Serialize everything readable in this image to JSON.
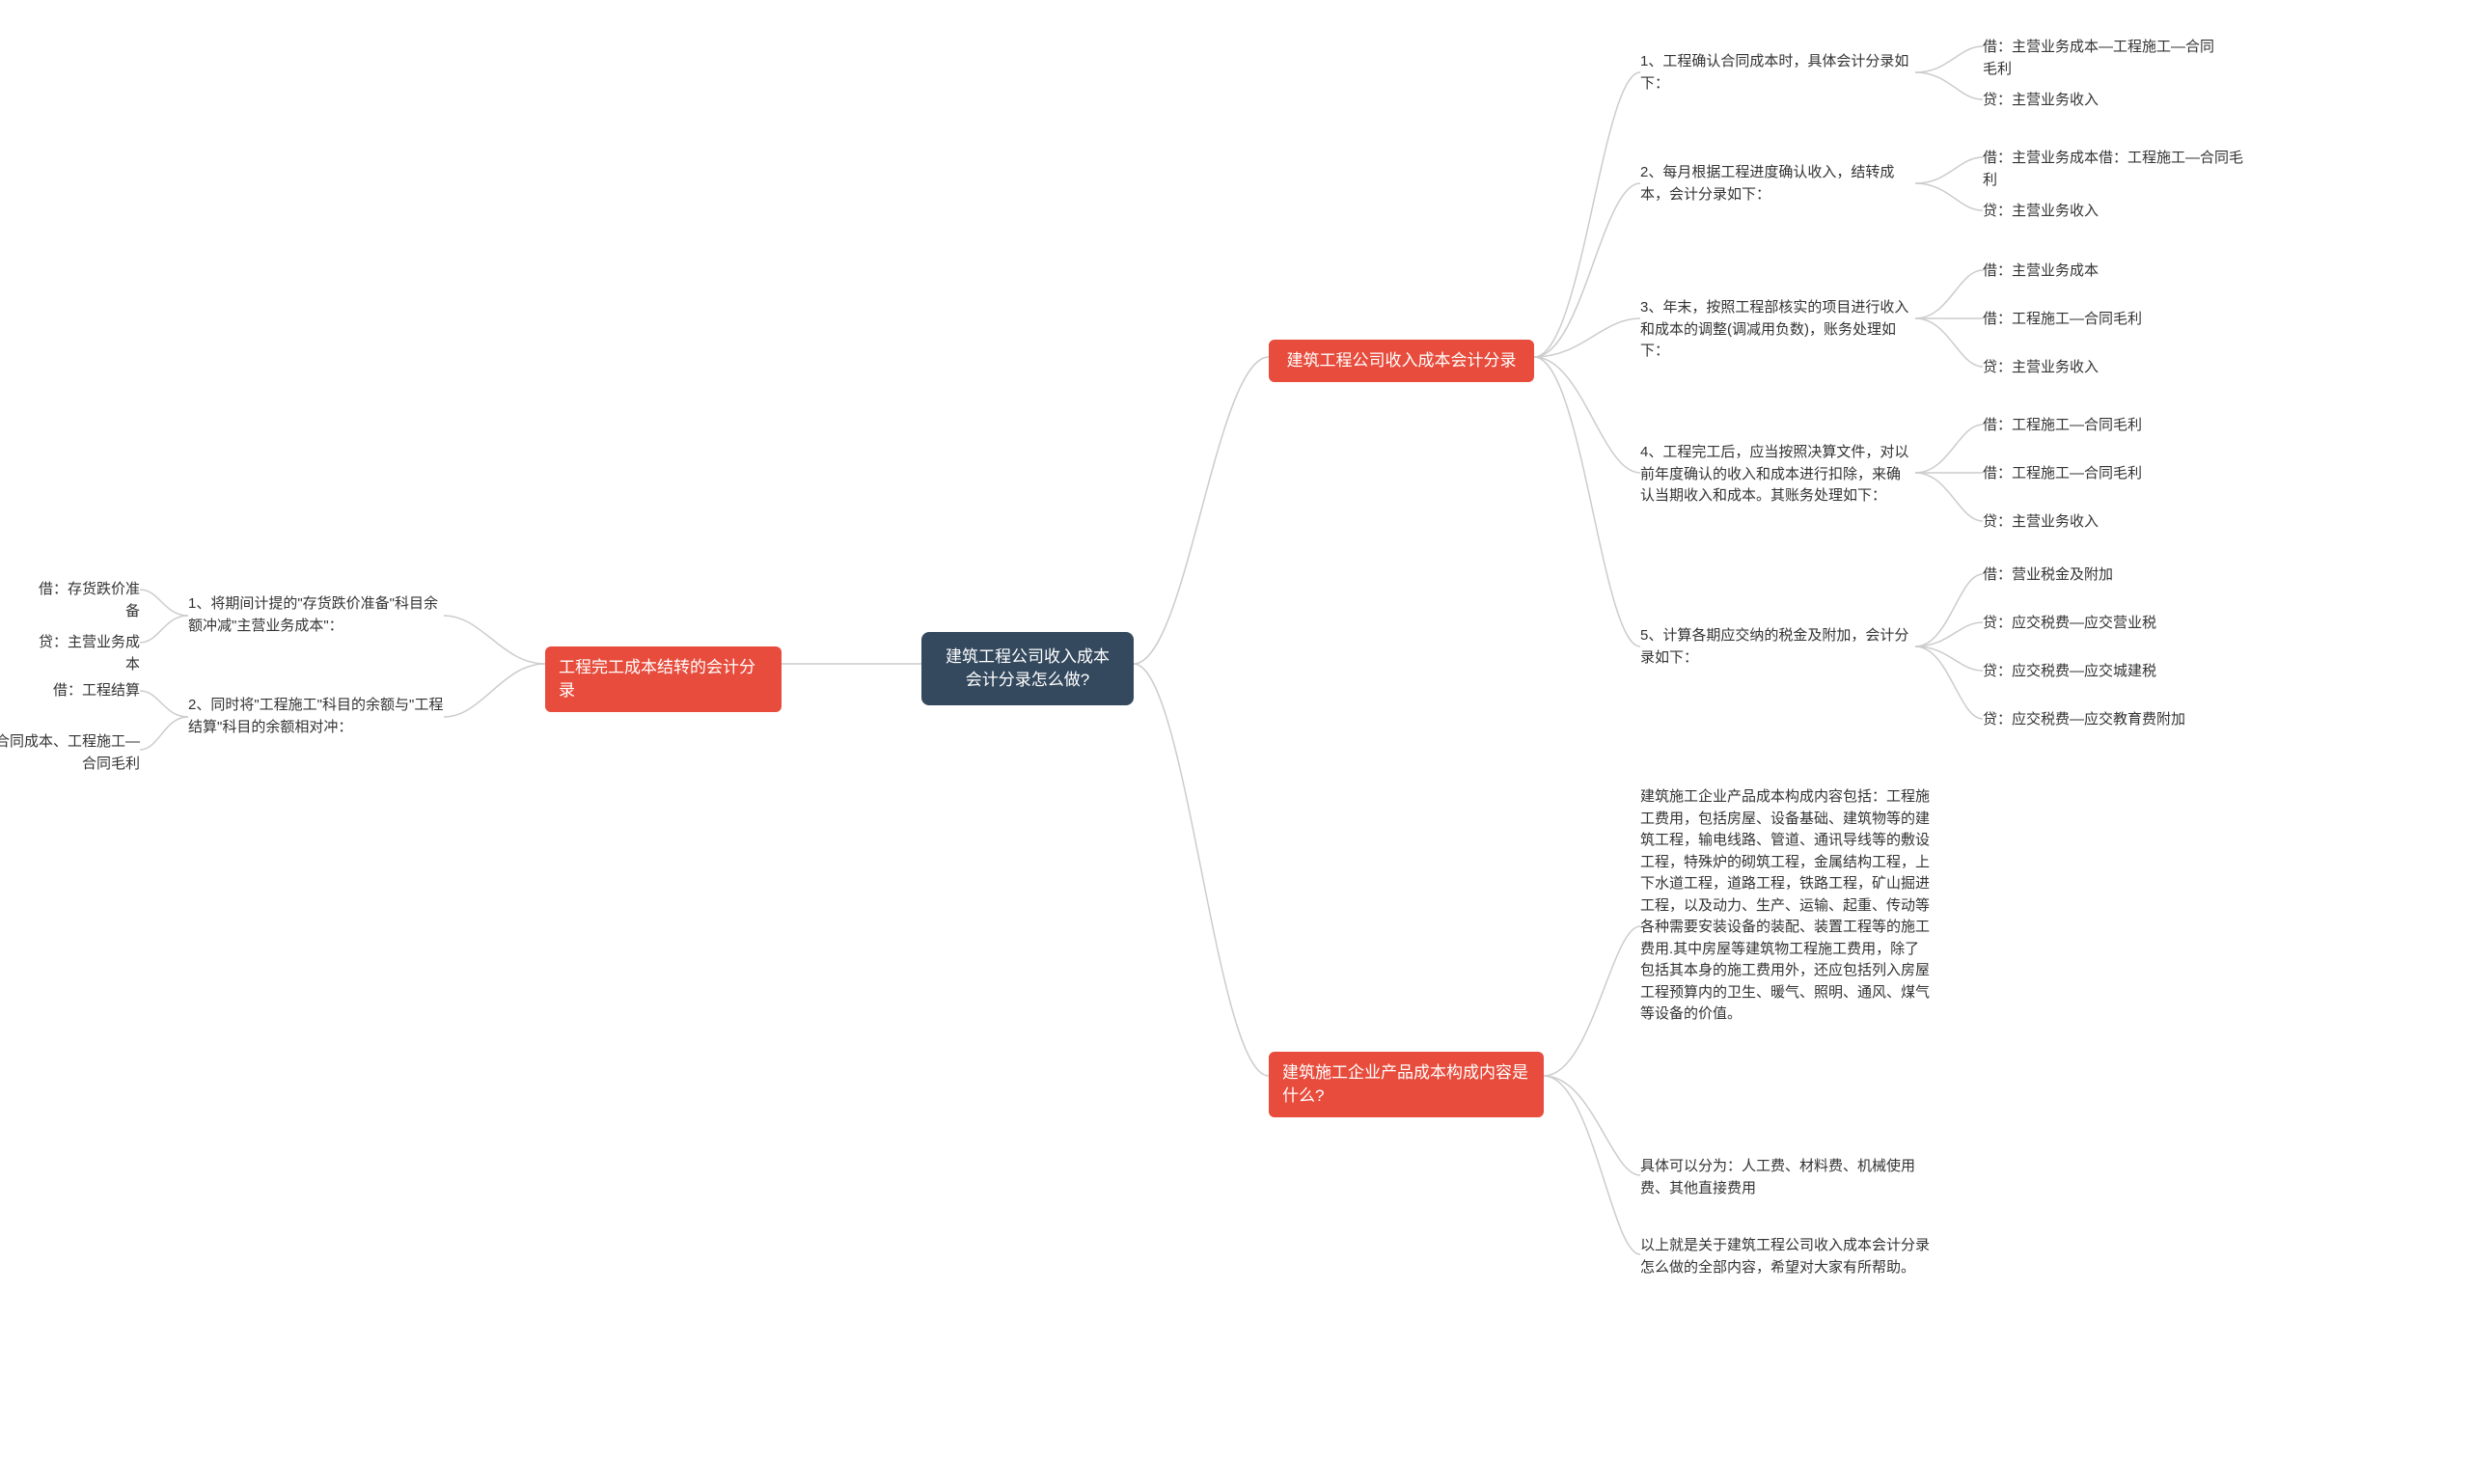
{
  "root": {
    "title": "建筑工程公司收入成本会计分录怎么做?"
  },
  "right": {
    "b1": {
      "label": "建筑工程公司收入成本会计分录",
      "i1": {
        "label": "1、工程确认合同成本时，具体会计分录如下：",
        "c1": "借：主营业务成本—工程施工—合同毛利",
        "c2": "贷：主营业务收入"
      },
      "i2": {
        "label": "2、每月根据工程进度确认收入，结转成本，会计分录如下：",
        "c1": "借：主营业务成本借：工程施工—合同毛利",
        "c2": "贷：主营业务收入"
      },
      "i3": {
        "label": "3、年末，按照工程部核实的项目进行收入和成本的调整(调减用负数)，账务处理如下：",
        "c1": "借：主营业务成本",
        "c2": "借：工程施工—合同毛利",
        "c3": "贷：主营业务收入"
      },
      "i4": {
        "label": "4、工程完工后，应当按照决算文件，对以前年度确认的收入和成本进行扣除，来确认当期收入和成本。其账务处理如下：",
        "c1": "借：工程施工—合同毛利",
        "c2": "借：工程施工—合同毛利",
        "c3": "贷：主营业务收入"
      },
      "i5": {
        "label": "5、计算各期应交纳的税金及附加，会计分录如下：",
        "c1": "借：营业税金及附加",
        "c2": "贷：应交税费—应交营业税",
        "c3": "贷：应交税费—应交城建税",
        "c4": "贷：应交税费—应交教育费附加"
      }
    },
    "b2": {
      "label": "建筑施工企业产品成本构成内容是什么?",
      "p1": "建筑施工企业产品成本构成内容包括：工程施工费用，包括房屋、设备基础、建筑物等的建筑工程，输电线路、管道、通讯导线等的敷设工程，特殊炉的砌筑工程，金属结构工程，上下水道工程，道路工程，铁路工程，矿山掘进工程，以及动力、生产、运输、起重、传动等各种需要安装设备的装配、装置工程等的施工费用.其中房屋等建筑物工程施工费用，除了包括其本身的施工费用外，还应包括列入房屋工程预算内的卫生、暖气、照明、通风、煤气等设备的价值。",
      "p2": "具体可以分为：人工费、材料费、机械使用费、其他直接费用",
      "p3": "以上就是关于建筑工程公司收入成本会计分录怎么做的全部内容，希望对大家有所帮助。"
    }
  },
  "left": {
    "b1": {
      "label": "工程完工成本结转的会计分录",
      "i1": {
        "label": "1、将期间计提的\"存货跌价准备\"科目余额冲减\"主营业务成本\"：",
        "c1": "借：存货跌价准备",
        "c2": "贷：主营业务成本"
      },
      "i2": {
        "label": "2、同时将\"工程施工\"科目的余额与\"工程结算\"科目的余额相对冲：",
        "c1": "借：工程结算",
        "c2": "贷：工程施工—合同成本、工程施工—合同毛利"
      }
    }
  }
}
